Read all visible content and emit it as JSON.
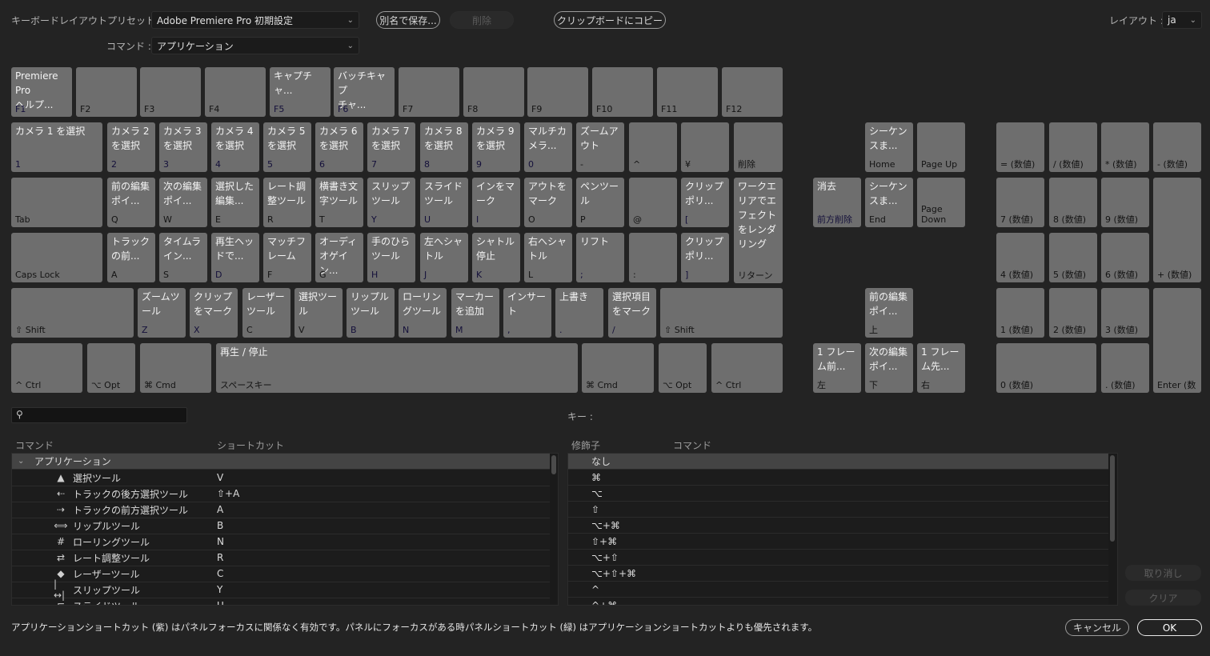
{
  "header": {
    "preset_label": "キーボードレイアウトプリセット :",
    "preset_value": "Adobe Premiere Pro 初期設定",
    "command_label": "コマンド :",
    "command_value": "アプリケーション",
    "save_as_label": "別名で保存...",
    "delete_label": "削除",
    "copy_clipboard_label": "クリップボードにコピー",
    "layout_label": "レイアウト :",
    "layout_value": "ja"
  },
  "keyboard": {
    "row_fn": [
      {
        "key": "F1",
        "cmd": "Premiere Pro\nヘルプ...",
        "type": "app"
      },
      {
        "key": "F2",
        "cmd": "",
        "type": "none"
      },
      {
        "key": "F3",
        "cmd": "",
        "type": "none"
      },
      {
        "key": "F4",
        "cmd": "",
        "type": "none"
      },
      {
        "key": "F5",
        "cmd": "キャプチャ...",
        "type": "app"
      },
      {
        "key": "F6",
        "cmd": "バッチキャプ\nチャ...",
        "type": "app"
      },
      {
        "key": "F7",
        "cmd": "",
        "type": "none"
      },
      {
        "key": "F8",
        "cmd": "",
        "type": "none"
      },
      {
        "key": "F9",
        "cmd": "",
        "type": "none"
      },
      {
        "key": "F10",
        "cmd": "",
        "type": "none"
      },
      {
        "key": "F11",
        "cmd": "",
        "type": "none"
      },
      {
        "key": "F12",
        "cmd": "",
        "type": "none"
      }
    ],
    "row_num": [
      {
        "key": "1",
        "cmd": "カメラ 1 を選択",
        "type": "app"
      },
      {
        "key": "2",
        "cmd": "カメラ 2\nを選択",
        "type": "app"
      },
      {
        "key": "3",
        "cmd": "カメラ 3\nを選択",
        "type": "app"
      },
      {
        "key": "4",
        "cmd": "カメラ 4\nを選択",
        "type": "app"
      },
      {
        "key": "5",
        "cmd": "カメラ 5\nを選択",
        "type": "app"
      },
      {
        "key": "6",
        "cmd": "カメラ 6\nを選択",
        "type": "app"
      },
      {
        "key": "7",
        "cmd": "カメラ 7\nを選択",
        "type": "app"
      },
      {
        "key": "8",
        "cmd": "カメラ 8\nを選択",
        "type": "app"
      },
      {
        "key": "9",
        "cmd": "カメラ 9\nを選択",
        "type": "app"
      },
      {
        "key": "0",
        "cmd": "マルチカ\nメラ...",
        "type": "app"
      },
      {
        "key": "-",
        "cmd": "ズームア\nウト",
        "type": "mixed-app"
      },
      {
        "key": "^",
        "cmd": "",
        "type": "none"
      },
      {
        "key": "¥",
        "cmd": "",
        "type": "none"
      },
      {
        "key": "削除",
        "cmd": "",
        "type": "mixed-none"
      }
    ],
    "row_q": [
      {
        "key": "Tab",
        "cmd": "",
        "type": "wide-none"
      },
      {
        "key": "Q",
        "cmd": "前の編集\nポイ...",
        "type": "mixed-app"
      },
      {
        "key": "W",
        "cmd": "次の編集\nポイ...",
        "type": "mixed-app"
      },
      {
        "key": "E",
        "cmd": "選択した\n編集...",
        "type": "mixed-app"
      },
      {
        "key": "R",
        "cmd": "レート調\n整ツール",
        "type": "mixed-app"
      },
      {
        "key": "T",
        "cmd": "横書き文\n字ツール",
        "type": "mixed-app"
      },
      {
        "key": "Y",
        "cmd": "スリップ\nツール",
        "type": "app"
      },
      {
        "key": "U",
        "cmd": "スライド\nツール",
        "type": "app"
      },
      {
        "key": "I",
        "cmd": "インをマ\nーク",
        "type": "app"
      },
      {
        "key": "O",
        "cmd": "アウトを\nマーク",
        "type": "mixed-app"
      },
      {
        "key": "P",
        "cmd": "ペンツー\nル",
        "type": "mixed-app"
      },
      {
        "key": "@",
        "cmd": "",
        "type": "none"
      },
      {
        "key": "[",
        "cmd": "クリップ\nポリ...",
        "type": "app"
      },
      {
        "key": "リターン",
        "cmd": "ワークエ\nリアでエ\nフェクト\nをレンダ\nリング",
        "type": "mixed-app"
      }
    ],
    "row_a": [
      {
        "key": "Caps Lock",
        "cmd": "",
        "type": "dark"
      },
      {
        "key": "A",
        "cmd": "トラック\nの前...",
        "type": "mixed-app"
      },
      {
        "key": "S",
        "cmd": "タイムラ\nイン...",
        "type": "mixed-app"
      },
      {
        "key": "D",
        "cmd": "再生ヘッ\nドで...",
        "type": "app"
      },
      {
        "key": "F",
        "cmd": "マッチフ\nレーム",
        "type": "mixed-app"
      },
      {
        "key": "G",
        "cmd": "オーディ\nオゲイン...",
        "type": "mixed-app"
      },
      {
        "key": "H",
        "cmd": "手のひら\nツール",
        "type": "app"
      },
      {
        "key": "J",
        "cmd": "左へシャ\nトル",
        "type": "app"
      },
      {
        "key": "K",
        "cmd": "シャトル\n停止",
        "type": "app"
      },
      {
        "key": "L",
        "cmd": "右へシャ\nトル",
        "type": "mixed-app"
      },
      {
        "key": ";",
        "cmd": "リフト",
        "type": "app"
      },
      {
        "key": ":",
        "cmd": "",
        "type": "none"
      },
      {
        "key": "]",
        "cmd": "クリップ\nポリ...",
        "type": "app"
      }
    ],
    "row_z": [
      {
        "key": "⇧ Shift",
        "cmd": "",
        "type": "dark"
      },
      {
        "key": "Z",
        "cmd": "ズームツ\nール",
        "type": "app"
      },
      {
        "key": "X",
        "cmd": "クリップ\nをマーク",
        "type": "app"
      },
      {
        "key": "C",
        "cmd": "レーザー\nツール",
        "type": "mixed-app"
      },
      {
        "key": "V",
        "cmd": "選択ツー\nル",
        "type": "mixed-app"
      },
      {
        "key": "B",
        "cmd": "リップル\nツール",
        "type": "app"
      },
      {
        "key": "N",
        "cmd": "ローリン\nグツール",
        "type": "app"
      },
      {
        "key": "M",
        "cmd": "マーカー\nを追加",
        "type": "app"
      },
      {
        "key": ",",
        "cmd": "インサー\nト",
        "type": "app"
      },
      {
        "key": ".",
        "cmd": "上書き",
        "type": "app"
      },
      {
        "key": "/",
        "cmd": "選択項目\nをマーク",
        "type": "app"
      },
      {
        "key": "⇧ Shift",
        "cmd": "",
        "type": "dark"
      }
    ],
    "row_space": [
      {
        "key": "^ Ctrl",
        "cmd": "",
        "type": "dark"
      },
      {
        "key": "⌥ Opt",
        "cmd": "",
        "type": "dark"
      },
      {
        "key": "⌘ Cmd",
        "cmd": "",
        "type": "dark"
      },
      {
        "key": "スペースキー",
        "cmd": "再生 / 停止",
        "type": "wide-app"
      },
      {
        "key": "⌘ Cmd",
        "cmd": "",
        "type": "dark"
      },
      {
        "key": "⌥ Opt",
        "cmd": "",
        "type": "dark"
      },
      {
        "key": "^ Ctrl",
        "cmd": "",
        "type": "dark"
      }
    ],
    "nav": [
      {
        "key": "Home",
        "cmd": "シーケン\nスま...",
        "type": "mixed-app"
      },
      {
        "key": "Page Up",
        "cmd": "",
        "type": "mixed-none"
      },
      {
        "key": "前方削除",
        "cmd": "消去",
        "type": "app"
      },
      {
        "key": "End",
        "cmd": "シーケン\nスま...",
        "type": "mixed-app"
      },
      {
        "key": "Page\nDown",
        "cmd": "",
        "type": "mixed-none"
      },
      {
        "key": "上",
        "cmd": "前の編集\nポイ...",
        "type": "mixed-app"
      },
      {
        "key": "左",
        "cmd": "1 フレー\nム前...",
        "type": "mixed-app"
      },
      {
        "key": "下",
        "cmd": "次の編集\nポイ...",
        "type": "mixed-app"
      },
      {
        "key": "右",
        "cmd": "1 フレー\nム先...",
        "type": "mixed-app"
      }
    ],
    "numpad": [
      {
        "key": "= (数値)",
        "type": "none"
      },
      {
        "key": "/ (数値)",
        "type": "none"
      },
      {
        "key": "* (数値)",
        "type": "none"
      },
      {
        "key": "- (数値)",
        "type": "none"
      },
      {
        "key": "7 (数値)",
        "type": "none"
      },
      {
        "key": "8 (数値)",
        "type": "none"
      },
      {
        "key": "9 (数値)",
        "type": "none"
      },
      {
        "key": "+ (数値)",
        "type": "none"
      },
      {
        "key": "4 (数値)",
        "type": "none"
      },
      {
        "key": "5 (数値)",
        "type": "none"
      },
      {
        "key": "6 (数値)",
        "type": "none"
      },
      {
        "key": "1 (数値)",
        "type": "none"
      },
      {
        "key": "2 (数値)",
        "type": "none"
      },
      {
        "key": "3 (数値)",
        "type": "none"
      },
      {
        "key": "Enter (数",
        "type": "none"
      },
      {
        "key": "0 (数値)",
        "type": "none"
      },
      {
        "key": ". (数値)",
        "type": "none"
      }
    ]
  },
  "search": {
    "placeholder": "",
    "value": ""
  },
  "commands_table": {
    "col_command": "コマンド",
    "col_shortcut": "ショートカット",
    "group": "アプリケーション",
    "rows": [
      {
        "icon": "selection-tool-icon",
        "glyph": "▲",
        "name": "選択ツール",
        "shortcut": "V"
      },
      {
        "icon": "track-select-backward-icon",
        "glyph": "⇠",
        "name": "トラックの後方選択ツール",
        "shortcut": "⇧+A"
      },
      {
        "icon": "track-select-forward-icon",
        "glyph": "⇢",
        "name": "トラックの前方選択ツール",
        "shortcut": "A"
      },
      {
        "icon": "ripple-edit-icon",
        "glyph": "⟺",
        "name": "リップルツール",
        "shortcut": "B"
      },
      {
        "icon": "rolling-edit-icon",
        "glyph": "#",
        "name": "ローリングツール",
        "shortcut": "N"
      },
      {
        "icon": "rate-stretch-icon",
        "glyph": "⇄",
        "name": "レート調整ツール",
        "shortcut": "R"
      },
      {
        "icon": "razor-icon",
        "glyph": "◆",
        "name": "レーザーツール",
        "shortcut": "C"
      },
      {
        "icon": "slip-tool-icon",
        "glyph": "|↔|",
        "name": "スリップツール",
        "shortcut": "Y"
      },
      {
        "icon": "slide-tool-icon",
        "glyph": "⊏",
        "name": "スライドツール",
        "shortcut": "U"
      }
    ]
  },
  "key_panel": {
    "key_label": "キー :",
    "col_modifier": "修飾子",
    "col_command": "コマンド",
    "rows": [
      {
        "modifier": "なし",
        "command": ""
      },
      {
        "modifier": "⌘",
        "command": ""
      },
      {
        "modifier": "⌥",
        "command": ""
      },
      {
        "modifier": "⇧",
        "command": ""
      },
      {
        "modifier": "⌥+⌘",
        "command": ""
      },
      {
        "modifier": "⇧+⌘",
        "command": ""
      },
      {
        "modifier": "⌥+⇧",
        "command": ""
      },
      {
        "modifier": "⌥+⇧+⌘",
        "command": ""
      },
      {
        "modifier": "^",
        "command": ""
      },
      {
        "modifier": "^+⌘",
        "command": ""
      }
    ],
    "undo_label": "取り消し",
    "clear_label": "クリア"
  },
  "footer": {
    "note": "アプリケーションショートカット (紫) はパネルフォーカスに関係なく有効です。パネルにフォーカスがある時パネルショートカット (緑) はアプリケーションショートカットよりも優先されます。",
    "cancel_label": "キャンセル",
    "ok_label": "OK"
  },
  "colors": {
    "app_shortcut": "#6b4fbb",
    "panel_shortcut": "#4fae8b",
    "unassigned": "#6e6e6e",
    "background": "#232323"
  }
}
